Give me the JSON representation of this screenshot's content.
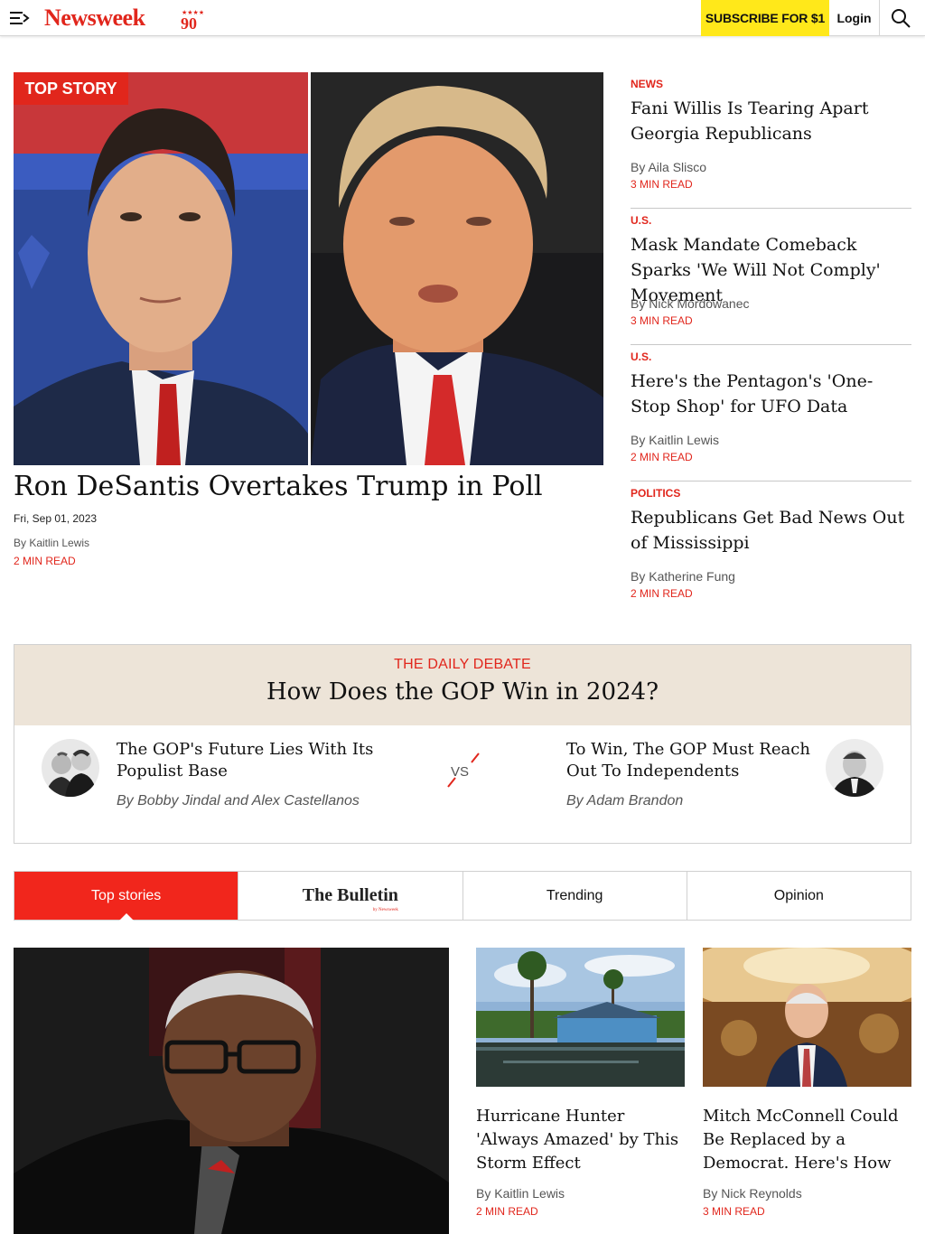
{
  "header": {
    "logo": "Newsweek",
    "logo_badge": "90",
    "subscribe_label": "SUBSCRIBE FOR $1",
    "login_label": "Login",
    "icons": [
      "menu-icon",
      "search-icon"
    ]
  },
  "top_story": {
    "badge": "TOP STORY",
    "title": "Ron DeSantis Overtakes Trump in Poll",
    "date": "Fri, Sep 01, 2023",
    "byline": "By Kaitlin Lewis",
    "read_time": "2 MIN READ"
  },
  "side_stories": [
    {
      "category": "NEWS",
      "title": "Fani Willis Is Tearing Apart Georgia Republicans",
      "byline": "By Aila Slisco",
      "read_time": "3 MIN READ"
    },
    {
      "category": "U.S.",
      "title": "Mask Mandate Comeback Sparks 'We Will Not Comply' Movement",
      "byline": "By Nick Mordowanec",
      "read_time": "3 MIN READ"
    },
    {
      "category": "U.S.",
      "title": "Here's the Pentagon's 'One-Stop Shop' for UFO Data",
      "byline": "By Kaitlin Lewis",
      "read_time": "2 MIN READ"
    },
    {
      "category": "POLITICS",
      "title": "Republicans Get Bad News Out of Mississippi",
      "byline": "By Katherine Fung",
      "read_time": "2 MIN READ"
    }
  ],
  "debate": {
    "kicker": "THE DAILY DEBATE",
    "title": "How Does the GOP Win in 2024?",
    "vs": "VS",
    "left": {
      "title": "The GOP's Future Lies With Its Populist Base",
      "byline": "By Bobby Jindal and Alex Castellanos"
    },
    "right": {
      "title": "To Win, The GOP Must Reach Out To Independents",
      "byline": "By Adam Brandon"
    }
  },
  "tabs": [
    {
      "label": "Top stories",
      "active": true
    },
    {
      "label": "The Bulletin",
      "brand_sub": "by Newsweek"
    },
    {
      "label": "Trending"
    },
    {
      "label": "Opinion"
    }
  ],
  "cards": [
    {
      "title": "Hurricane Hunter 'Always Amazed' by This Storm Effect",
      "byline": "By Kaitlin Lewis",
      "read_time": "2 MIN READ"
    },
    {
      "title": "Mitch McConnell Could Be Replaced by a Democrat. Here's How",
      "byline": "By Nick Reynolds",
      "read_time": "3 MIN READ"
    }
  ],
  "colors": {
    "brand_red": "#e1261c",
    "subscribe_yellow": "#ffe81a",
    "debate_bg": "#ede4d8"
  }
}
